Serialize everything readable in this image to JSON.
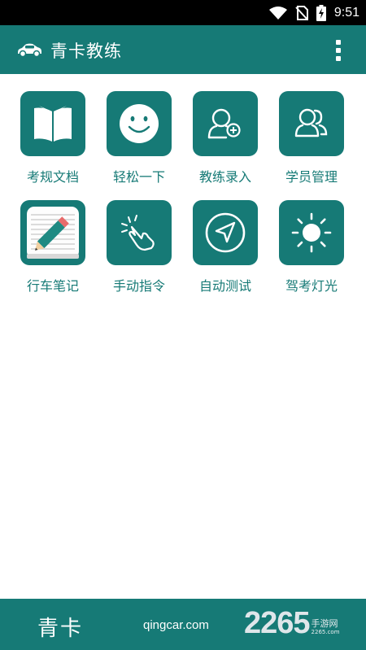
{
  "status": {
    "time": "9:51"
  },
  "appbar": {
    "title": "青卡教练"
  },
  "tiles": [
    {
      "label": "考规文档",
      "icon": "open-book-icon"
    },
    {
      "label": "轻松一下",
      "icon": "smiley-face-icon"
    },
    {
      "label": "教练录入",
      "icon": "add-user-icon"
    },
    {
      "label": "学员管理",
      "icon": "users-icon"
    },
    {
      "label": "行车笔记",
      "icon": "notepad-pencil-icon"
    },
    {
      "label": "手动指令",
      "icon": "tap-gesture-icon"
    },
    {
      "label": "自动测试",
      "icon": "compass-navigation-icon"
    },
    {
      "label": "驾考灯光",
      "icon": "sun-light-icon"
    }
  ],
  "footer": {
    "brand": "青卡",
    "url": "qingcar.com"
  },
  "watermark": {
    "number": "2265",
    "cn": "手游网",
    "en": "2265.com"
  },
  "colors": {
    "primary": "#167a76",
    "statusbar": "#000000",
    "background": "#ffffff"
  }
}
